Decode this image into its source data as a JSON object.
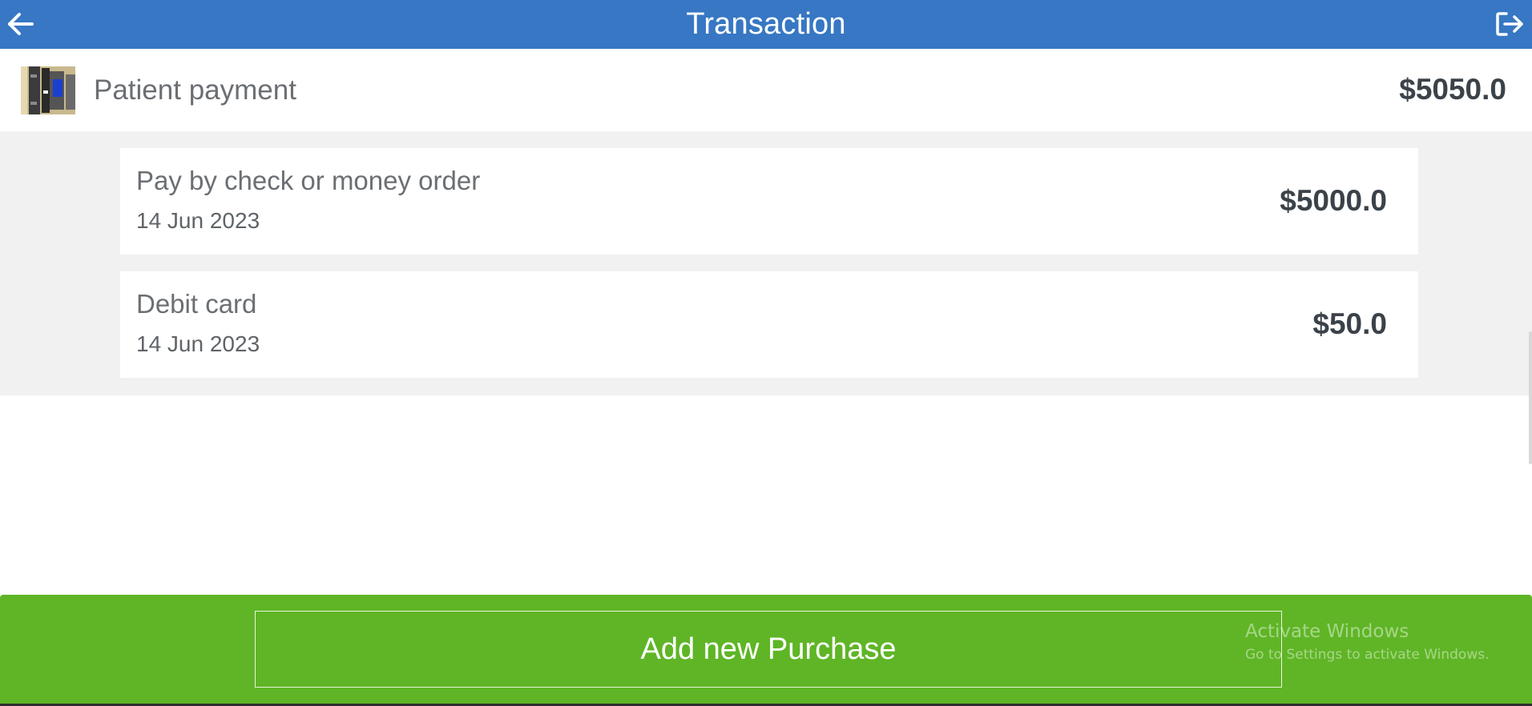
{
  "header": {
    "title": "Transaction",
    "back_icon": "arrow-left-icon",
    "logout_icon": "sign-out-icon",
    "background_color": "#3777c3"
  },
  "summary": {
    "thumbnail_icon": "payment-terminal-thumbnail",
    "label": "Patient payment",
    "amount": "$5050.0"
  },
  "transactions": [
    {
      "method": "Pay by check or money order",
      "date": "14 Jun 2023",
      "amount": "$5000.0"
    },
    {
      "method": "Debit card",
      "date": "14 Jun 2023",
      "amount": "$50.0"
    }
  ],
  "footer": {
    "add_button_label": "Add new Purchase",
    "background_color": "#5fb526"
  },
  "watermark": {
    "title": "Activate Windows",
    "subtitle": "Go to Settings to activate Windows."
  }
}
